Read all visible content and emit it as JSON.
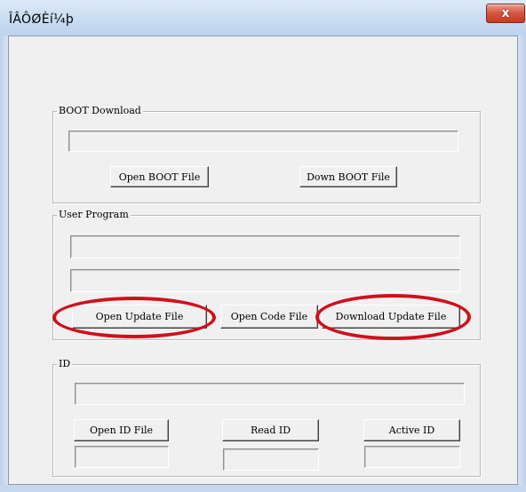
{
  "window": {
    "title": "ÎÂÔØÈí¼þ",
    "close_label": "x"
  },
  "boot": {
    "group_label": "BOOT Download",
    "path_value": "",
    "open_label": "Open BOOT File",
    "down_label": "Down BOOT File"
  },
  "user": {
    "group_label": "User Program",
    "path1_value": "",
    "path2_value": "",
    "open_update_label": "Open Update File",
    "open_code_label": "Open Code File",
    "download_update_label": "Download Update File"
  },
  "id": {
    "group_label": "ID",
    "path_value": "",
    "open_label": "Open ID File",
    "read_label": "Read ID",
    "active_label": "Active ID"
  },
  "colors": {
    "highlight_ellipse": "#d0101a",
    "close_button": "#c53b23"
  }
}
